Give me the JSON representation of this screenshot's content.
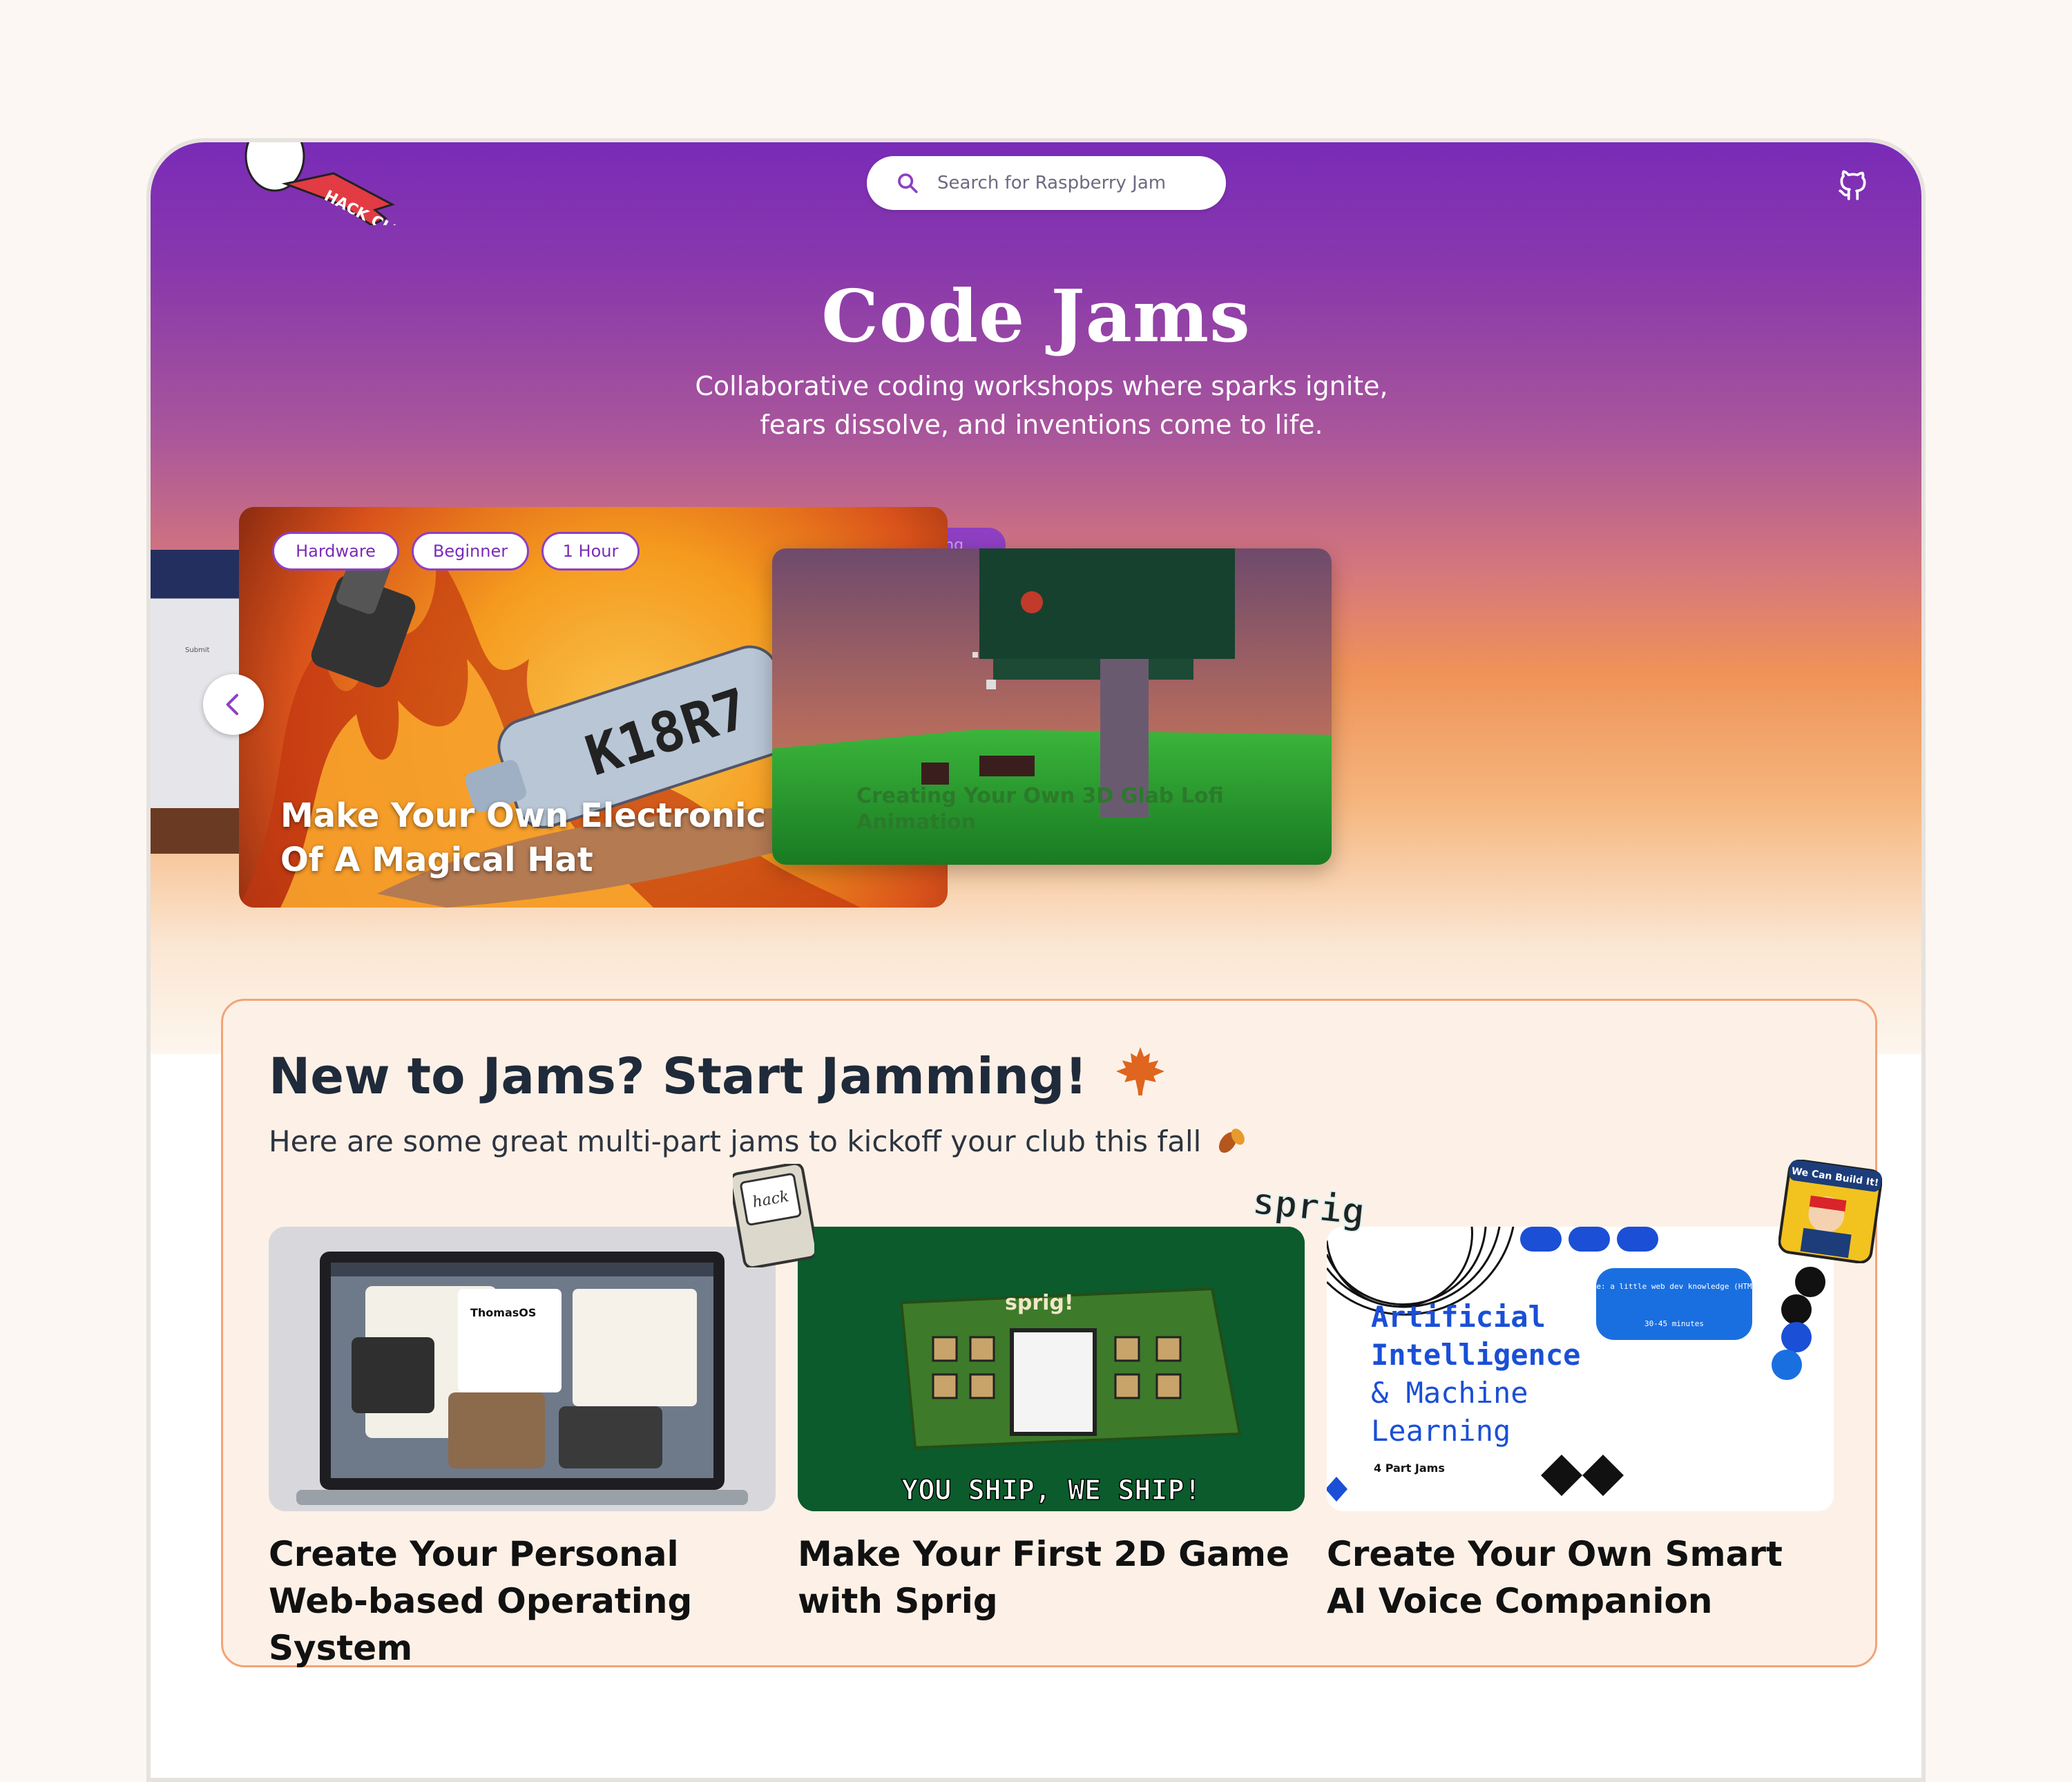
{
  "header": {
    "logo_text": "HACK CLUB",
    "search_placeholder": "Search for Raspberry Jam"
  },
  "hero": {
    "title": "Code Jams",
    "subtitle": "Collaborative coding workshops where sparks ignite, fears dissolve, and inventions come to life."
  },
  "carousel": {
    "main_card": {
      "tags": [
        "Hardware",
        "Beginner",
        "1 Hour"
      ],
      "title_line1": "Make Your Own Electronic Tra",
      "title_line2": "Of A Magical Hat",
      "art_text": "K18R7"
    },
    "behind_tag": "Trending",
    "second_card": {
      "title": "Creating Your Own 3D Glab Lofi Animation"
    },
    "left_peek_text": "Submit"
  },
  "start_section": {
    "heading": "New to Jams? Start Jamming!",
    "heading_icon": "maple-leaf-icon",
    "subheading": "Here are some great multi-part jams to kickoff your club this fall",
    "subheading_icon": "falling-leaves-icon",
    "cards": [
      {
        "title": "Create Your Personal Web-based Operating System",
        "sticker_text": "hack",
        "screen_text": "ThomasOS"
      },
      {
        "title": "Make Your First 2D Game with Sprig",
        "sticker_text": "sprig",
        "banner_text": "YOU SHIP, WE SHIP!",
        "board_text": "sprig!"
      },
      {
        "title": "Create Your Own Smart AI Voice Companion",
        "ai_line1": "Artificial",
        "ai_line2": "Intelligence",
        "ai_line3": "& Machine",
        "ai_line4": "Learning",
        "ai_part": "4 Part Jams",
        "bubble_text": "Prerequisite: a little web dev knowledge (HTML, JS, CSS)",
        "bubble_time": "30-45 minutes",
        "sticker_text": "We Can Build It!"
      }
    ]
  },
  "colors": {
    "purple": "#7a2bb8",
    "orange_border": "#f2a477",
    "box_bg": "#fdf1e7",
    "page_bg": "#fcf7f2"
  }
}
